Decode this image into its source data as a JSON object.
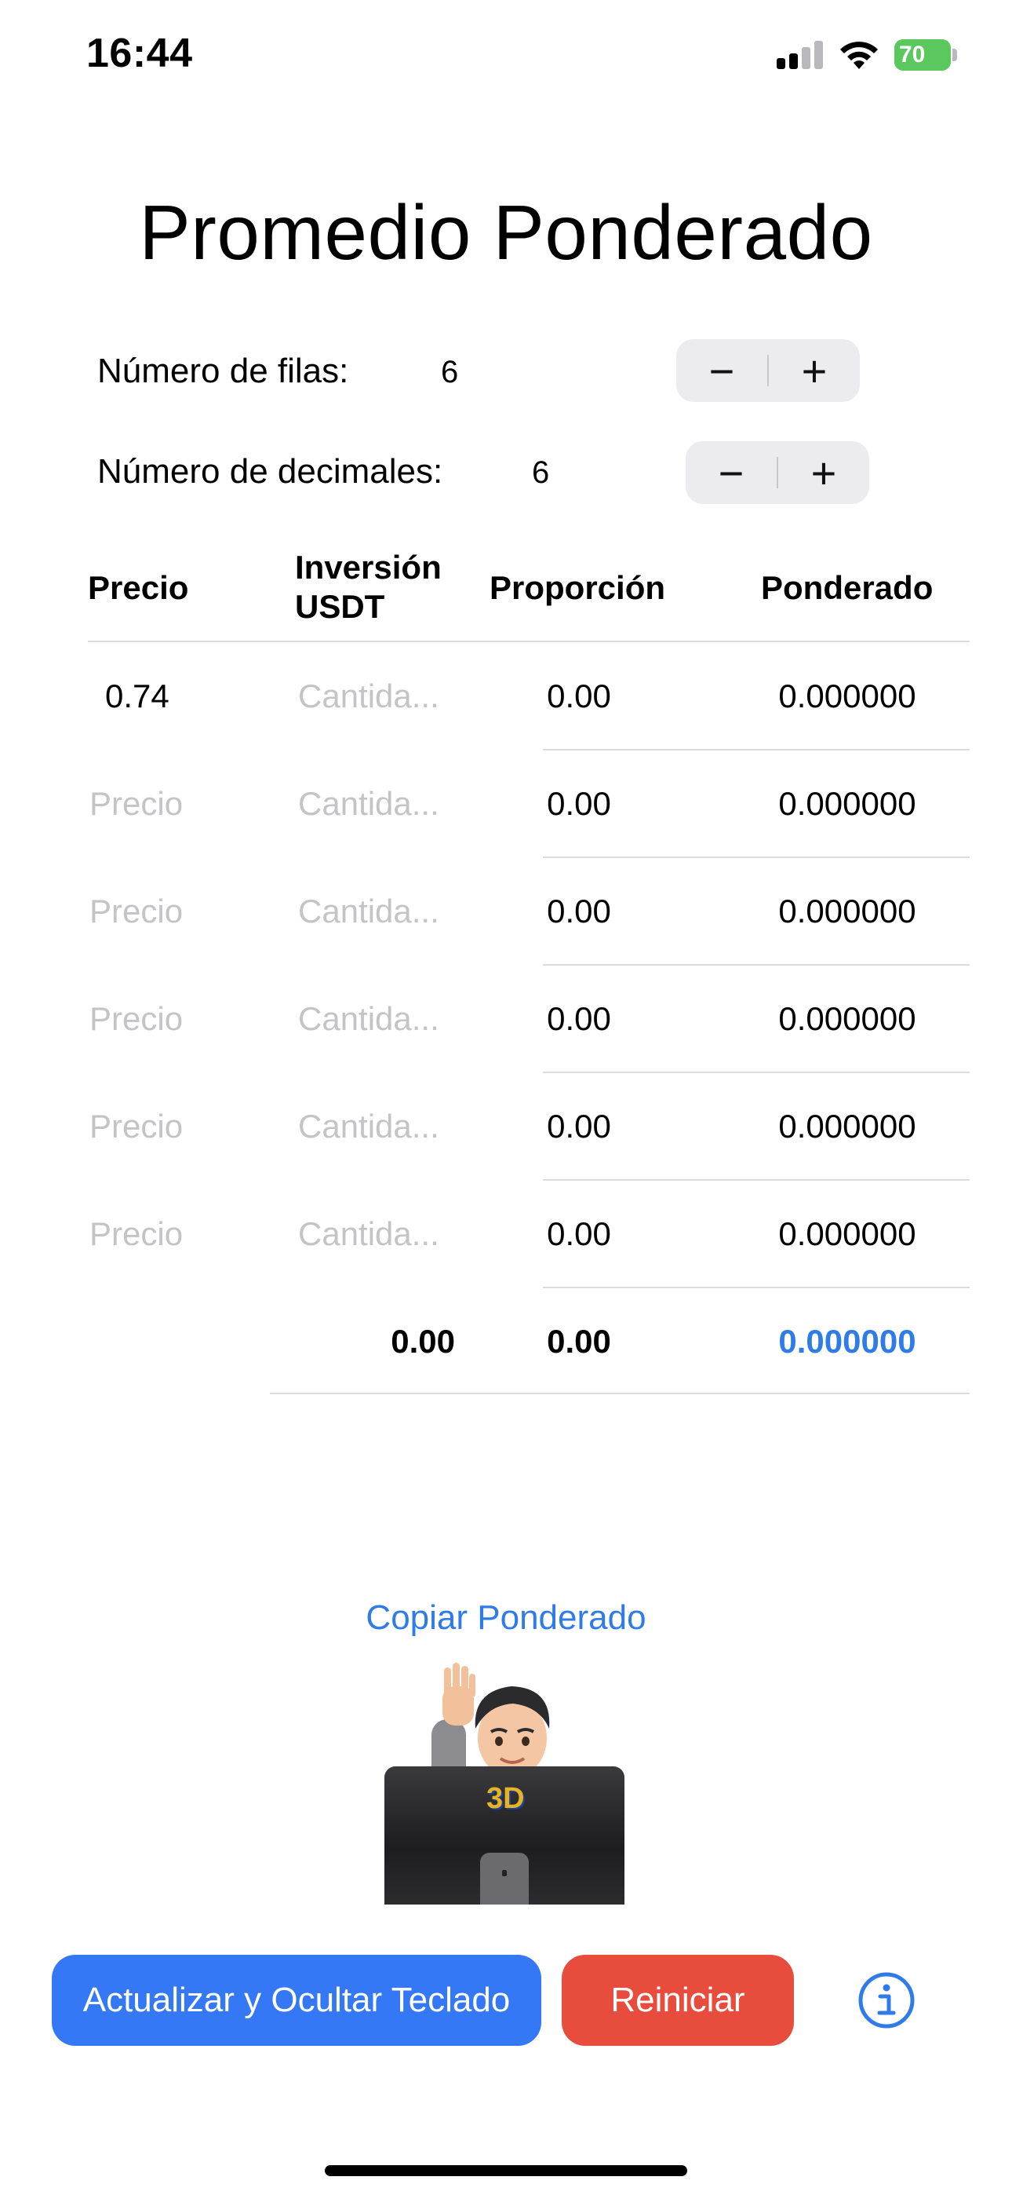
{
  "status_bar": {
    "time": "16:44",
    "battery": "70"
  },
  "title": "Promedio Ponderado",
  "rows_control": {
    "label": "Número de filas:",
    "value": "6",
    "minus": "−",
    "plus": "+"
  },
  "decimals_control": {
    "label": "Número de decimales:",
    "value": "6",
    "minus": "−",
    "plus": "+"
  },
  "table": {
    "headers": {
      "price": "Precio",
      "investment_line1": "Inversión",
      "investment_line2": "USDT",
      "proportion": "Proporción",
      "weighted": "Ponderado"
    },
    "rows": [
      {
        "price": "0.74",
        "price_is_placeholder": false,
        "amount": "Cantida...",
        "proportion": "0.00",
        "weighted": "0.000000"
      },
      {
        "price": "Precio",
        "price_is_placeholder": true,
        "amount": "Cantida...",
        "proportion": "0.00",
        "weighted": "0.000000"
      },
      {
        "price": "Precio",
        "price_is_placeholder": true,
        "amount": "Cantida...",
        "proportion": "0.00",
        "weighted": "0.000000"
      },
      {
        "price": "Precio",
        "price_is_placeholder": true,
        "amount": "Cantida...",
        "proportion": "0.00",
        "weighted": "0.000000"
      },
      {
        "price": "Precio",
        "price_is_placeholder": true,
        "amount": "Cantida...",
        "proportion": "0.00",
        "weighted": "0.000000"
      },
      {
        "price": "Precio",
        "price_is_placeholder": true,
        "amount": "Cantida...",
        "proportion": "0.00",
        "weighted": "0.000000"
      }
    ],
    "totals": {
      "investment": "0.00",
      "proportion": "0.00",
      "weighted": "0.000000"
    }
  },
  "copy_link": "Copiar Ponderado",
  "monitor_logo": "3D",
  "buttons": {
    "update": "Actualizar y Ocultar Teclado",
    "reset": "Reiniciar"
  },
  "colors": {
    "accent": "#2f7be8",
    "primary_button": "#3478f6",
    "danger_button": "#e84c3d",
    "battery": "#5bc85d"
  }
}
